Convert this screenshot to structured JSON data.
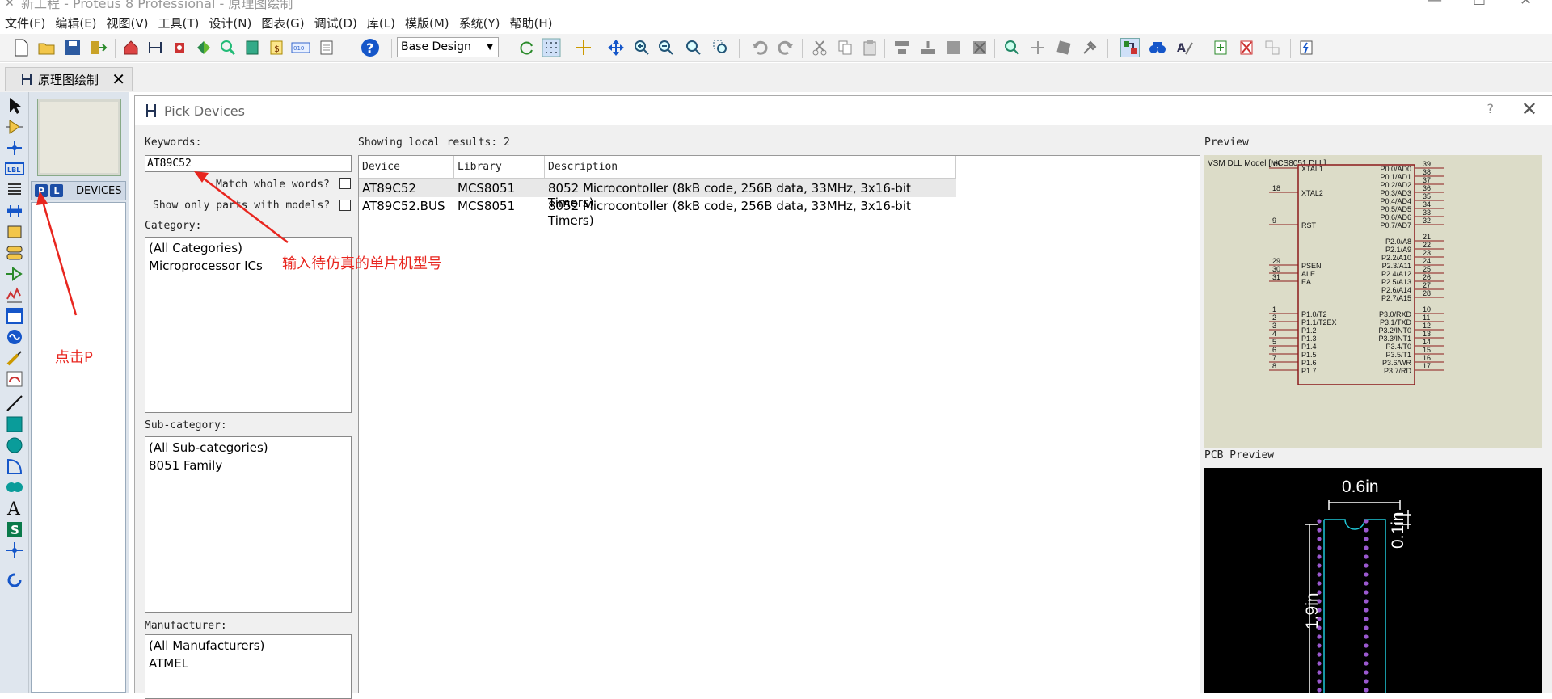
{
  "window": {
    "title": "新工程 - Proteus 8 Professional - 原理图绘制"
  },
  "menu": [
    "文件(F)",
    "编辑(E)",
    "视图(V)",
    "工具(T)",
    "设计(N)",
    "图表(G)",
    "调试(D)",
    "库(L)",
    "模版(M)",
    "系统(Y)",
    "帮助(H)"
  ],
  "toolbar": {
    "design_select": "Base Design"
  },
  "tab": {
    "label": "原理图绘制"
  },
  "side_panel": {
    "p_button": "P",
    "l_button": "L",
    "devices_label": "DEVICES"
  },
  "dialog": {
    "title": "Pick Devices",
    "help": "?",
    "keywords_label": "Keywords:",
    "keywords_value": "AT89C52",
    "match_whole_words": "Match whole words?",
    "show_only_models": "Show only parts with models?",
    "category_label": "Category:",
    "categories": [
      "(All Categories)",
      "Microprocessor ICs"
    ],
    "subcategory_label": "Sub-category:",
    "subcategories": [
      "(All Sub-categories)",
      "8051 Family"
    ],
    "manufacturer_label": "Manufacturer:",
    "manufacturers": [
      "(All Manufacturers)",
      "ATMEL"
    ],
    "results_label": "Showing local results: 2",
    "columns": [
      "Device",
      "Library",
      "Description"
    ],
    "rows": [
      {
        "device": "AT89C52",
        "library": "MCS8051",
        "description": "8052 Microcontoller (8kB code, 256B data, 33MHz, 3x16-bit Timers)"
      },
      {
        "device": "AT89C52.BUS",
        "library": "MCS8051",
        "description": "8052 Microcontoller (8kB code, 256B data, 33MHz, 3x16-bit Timers)"
      }
    ],
    "preview_label": "Preview",
    "preview_model": "VSM DLL Model [MCS8051.DLL]",
    "pcb_label": "PCB Preview",
    "pcb_width": "0.6in",
    "pcb_pitch": "0.1in",
    "pcb_length": "1.9in"
  },
  "chip": {
    "left_pins": [
      {
        "num": "19",
        "name": "XTAL1"
      },
      {
        "num": "18",
        "name": "XTAL2"
      },
      {
        "num": "9",
        "name": "RST"
      },
      {
        "num": "29",
        "name": "PSEN"
      },
      {
        "num": "30",
        "name": "ALE"
      },
      {
        "num": "31",
        "name": "EA"
      },
      {
        "num": "1",
        "name": "P1.0/T2"
      },
      {
        "num": "2",
        "name": "P1.1/T2EX"
      },
      {
        "num": "3",
        "name": "P1.2"
      },
      {
        "num": "4",
        "name": "P1.3"
      },
      {
        "num": "5",
        "name": "P1.4"
      },
      {
        "num": "6",
        "name": "P1.5"
      },
      {
        "num": "7",
        "name": "P1.6"
      },
      {
        "num": "8",
        "name": "P1.7"
      }
    ],
    "right_pins": [
      {
        "num": "39",
        "name": "P0.0/AD0"
      },
      {
        "num": "38",
        "name": "P0.1/AD1"
      },
      {
        "num": "37",
        "name": "P0.2/AD2"
      },
      {
        "num": "36",
        "name": "P0.3/AD3"
      },
      {
        "num": "35",
        "name": "P0.4/AD4"
      },
      {
        "num": "34",
        "name": "P0.5/AD5"
      },
      {
        "num": "33",
        "name": "P0.6/AD6"
      },
      {
        "num": "32",
        "name": "P0.7/AD7"
      },
      {
        "num": "21",
        "name": "P2.0/A8"
      },
      {
        "num": "22",
        "name": "P2.1/A9"
      },
      {
        "num": "23",
        "name": "P2.2/A10"
      },
      {
        "num": "24",
        "name": "P2.3/A11"
      },
      {
        "num": "25",
        "name": "P2.4/A12"
      },
      {
        "num": "26",
        "name": "P2.5/A13"
      },
      {
        "num": "27",
        "name": "P2.6/A14"
      },
      {
        "num": "28",
        "name": "P2.7/A15"
      },
      {
        "num": "10",
        "name": "P3.0/RXD"
      },
      {
        "num": "11",
        "name": "P3.1/TXD"
      },
      {
        "num": "12",
        "name": "P3.2/INT0"
      },
      {
        "num": "13",
        "name": "P3.3/INT1"
      },
      {
        "num": "14",
        "name": "P3.4/T0"
      },
      {
        "num": "15",
        "name": "P3.5/T1"
      },
      {
        "num": "16",
        "name": "P3.6/WR"
      },
      {
        "num": "17",
        "name": "P3.7/RD"
      }
    ]
  },
  "annotations": {
    "keyword_hint": "输入待仿真的单片机型号",
    "click_p": "点击P"
  },
  "colors": {
    "annotation": "#e8261f",
    "chip_outline": "#8b1a1a",
    "pcb_pad": "#9b59d0",
    "pcb_outline": "#1fc8d8"
  }
}
